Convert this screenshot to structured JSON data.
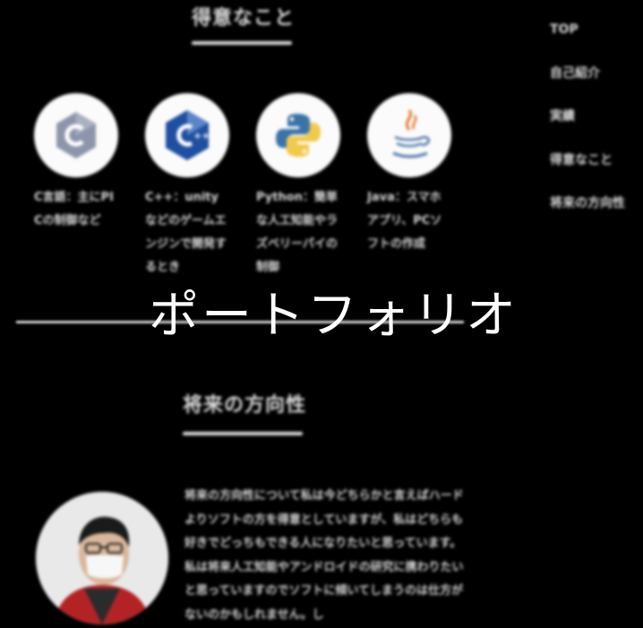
{
  "sections": {
    "skills_title": "得意なこと",
    "future_title": "将来の方向性"
  },
  "nav": {
    "items": [
      {
        "label": "TOP"
      },
      {
        "label": "自己紹介"
      },
      {
        "label": "実績"
      },
      {
        "label": "得意なこと"
      },
      {
        "label": "将来の方向性"
      }
    ]
  },
  "skills": [
    {
      "icon": "c-language-icon",
      "text": "C言語：主にPICの制御など"
    },
    {
      "icon": "cpp-icon",
      "text": "C++：unityなどのゲームエンジンで開発するとき"
    },
    {
      "icon": "python-icon",
      "text": "Python：簡単な人工知能やラズベリーパイの制御"
    },
    {
      "icon": "java-icon",
      "text": "Java：スマホアプリ、PCソフトの作成"
    }
  ],
  "hero": {
    "title": "ポートフォリオ"
  },
  "future": {
    "text": "将来の方向性について私は今どちらかと言えばハードよりソフトの方を得意としていますが、私はどちらも好きでどっちもできる人になりたいと思っています。私は将来人工知能やアンドロイドの研究に携わりたいと思っていますのでソフトに傾いてしまうのは仕方がないのかもしれません。し"
  },
  "colors": {
    "background": "#000000",
    "text": "#e6e6e6",
    "cpp_blue": "#1f4fa0",
    "python_blue": "#3b73a8",
    "python_yellow": "#f2c94c",
    "java_orange": "#e8732c",
    "java_blue": "#4a74a8"
  }
}
